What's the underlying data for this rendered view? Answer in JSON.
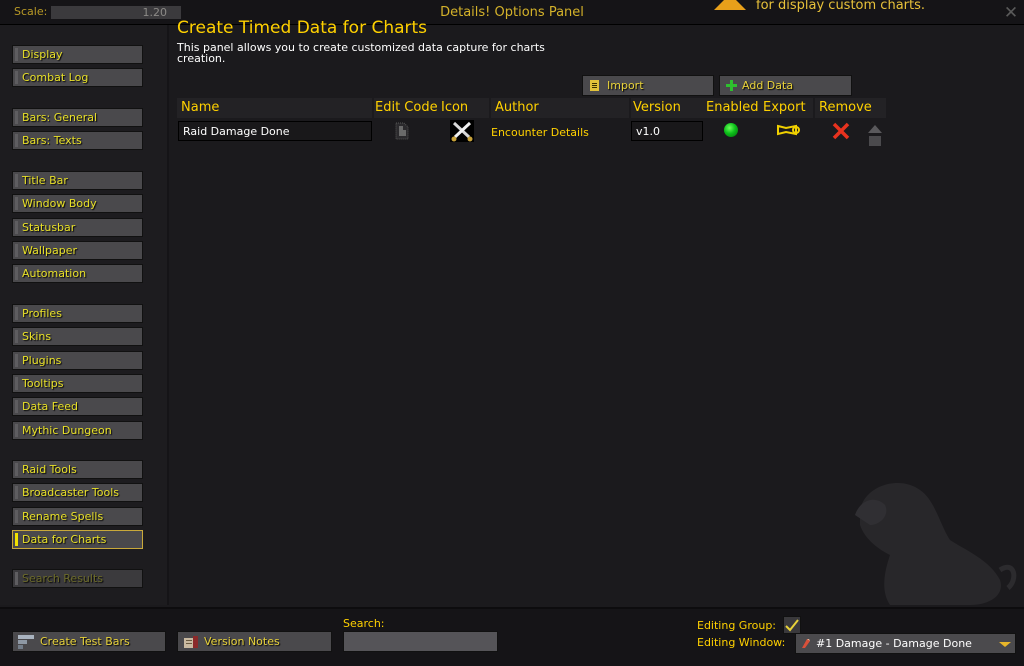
{
  "topbar": {
    "scale_label": "Scale:",
    "scale_value": "1.20",
    "window_title": "Details! Options Panel",
    "warning_text": "for display custom charts.",
    "close_icon": "close-icon"
  },
  "sidebar": {
    "groups": [
      [
        "Display",
        "Combat Log"
      ],
      [
        "Bars: General",
        "Bars: Texts"
      ],
      [
        "Title Bar",
        "Window Body",
        "Statusbar",
        "Wallpaper",
        "Automation"
      ],
      [
        "Profiles",
        "Skins",
        "Plugins",
        "Tooltips",
        "Data Feed",
        "Mythic Dungeon"
      ],
      [
        "Raid Tools",
        "Broadcaster Tools",
        "Rename Spells",
        "Data for Charts"
      ],
      [
        "Search Results"
      ]
    ],
    "active_item": "Data for Charts",
    "disabled_item": "Search Results"
  },
  "panel": {
    "title": "Create Timed Data for Charts",
    "description": "This panel allows you to create customized data capture for charts creation.",
    "import_label": "Import",
    "add_data_label": "Add Data"
  },
  "table": {
    "headers": {
      "name": "Name",
      "edit_code": "Edit Code",
      "icon": "Icon",
      "author": "Author",
      "version": "Version",
      "enabled": "Enabled",
      "export": "Export",
      "remove": "Remove"
    },
    "rows": [
      {
        "name": "Raid Damage Done",
        "icon": "crossed-swords-icon",
        "author": "Encounter Details",
        "version": "v1.0",
        "enabled": true
      }
    ]
  },
  "bottom": {
    "create_test_bars_label": "Create Test Bars",
    "version_notes_label": "Version Notes",
    "search_label": "Search:",
    "search_value": "",
    "editing_group_label": "Editing Group:",
    "editing_group_checked": true,
    "editing_window_label": "Editing Window:",
    "editing_window_value": "#1 Damage - Damage Done"
  },
  "colors": {
    "accent_gold": "#ffd100",
    "background": "#1b1a1d",
    "button": "#4a494c",
    "enabled_green": "#0cc01a",
    "remove_red": "#e8321e"
  }
}
